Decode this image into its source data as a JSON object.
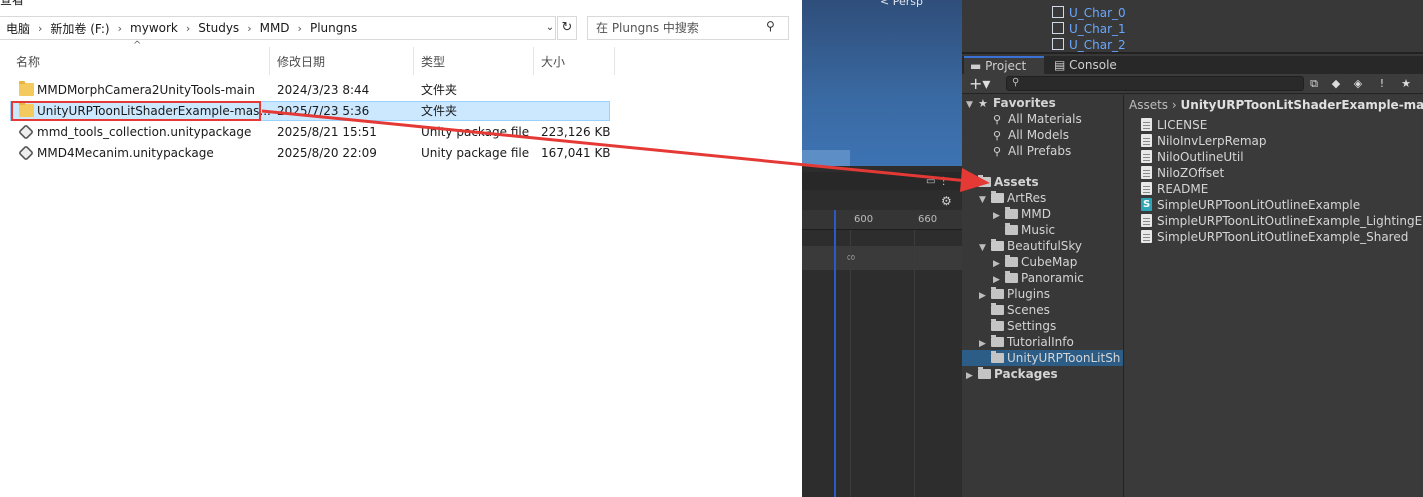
{
  "explorer": {
    "top_cut_text": "查看",
    "breadcrumb": [
      "电脑",
      "新加卷 (F:)",
      "mywork",
      "Studys",
      "MMD",
      "Plungns"
    ],
    "search_placeholder": "在 Plungns 中搜索",
    "columns": [
      "名称",
      "修改日期",
      "类型",
      "大小"
    ],
    "rows": [
      {
        "name": "MMDMorphCamera2UnityTools-main",
        "date": "2024/3/23 8:44",
        "type": "文件夹",
        "size": "",
        "icon": "folder-icon"
      },
      {
        "name": "UnityURPToonLitShaderExample-mas...",
        "date": "2025/7/23 5:36",
        "type": "文件夹",
        "size": "",
        "icon": "folder-icon"
      },
      {
        "name": "mmd_tools_collection.unitypackage",
        "date": "2025/8/21 15:51",
        "type": "Unity package file",
        "size": "223,126 KB",
        "icon": "unity-package-icon"
      },
      {
        "name": "MMD4Mecanim.unitypackage",
        "date": "2025/8/20 22:09",
        "type": "Unity package file",
        "size": "167,041 KB",
        "icon": "unity-package-icon"
      }
    ],
    "selected_row": 1
  },
  "scene": {
    "persp_label": "< Persp"
  },
  "timeline": {
    "ticks": [
      "600",
      "660"
    ],
    "infinity": "∞"
  },
  "hierarchy": {
    "items": [
      "U_Char_0",
      "U_Char_1",
      "U_Char_2"
    ]
  },
  "unity_tabs": {
    "project": "Project",
    "console": "Console"
  },
  "tree": {
    "favorites": "Favorites",
    "favorites_items": [
      "All Materials",
      "All Models",
      "All Prefabs"
    ],
    "assets": "Assets",
    "artres": "ArtRes",
    "mmd": "MMD",
    "music": "Music",
    "beautifulsky": "BeautifulSky",
    "cubemap": "CubeMap",
    "panoramic": "Panoramic",
    "plugins": "Plugins",
    "scenes": "Scenes",
    "settings": "Settings",
    "tutorialinfo": "TutorialInfo",
    "selected": "UnityURPToonLitSh",
    "packages": "Packages"
  },
  "content": {
    "crumb_root": "Assets",
    "crumb_sep": "›",
    "crumb_last": "UnityURPToonLitShaderExample-master",
    "files": [
      {
        "name": "LICENSE",
        "icon": "text-file-icon"
      },
      {
        "name": "NiloInvLerpRemap",
        "icon": "text-file-icon"
      },
      {
        "name": "NiloOutlineUtil",
        "icon": "text-file-icon"
      },
      {
        "name": "NiloZOffset",
        "icon": "text-file-icon"
      },
      {
        "name": "README",
        "icon": "text-file-icon"
      },
      {
        "name": "SimpleURPToonLitOutlineExample",
        "icon": "shader-icon"
      },
      {
        "name": "SimpleURPToonLitOutlineExample_LightingEqu",
        "icon": "text-file-icon"
      },
      {
        "name": "SimpleURPToonLitOutlineExample_Shared",
        "icon": "text-file-icon"
      }
    ]
  },
  "colors": {
    "annotation_red": "#e53935",
    "selection_blue": "#cce8ff",
    "unity_selection": "#2c5d87",
    "hierarchy_link": "#6aa6ff"
  }
}
